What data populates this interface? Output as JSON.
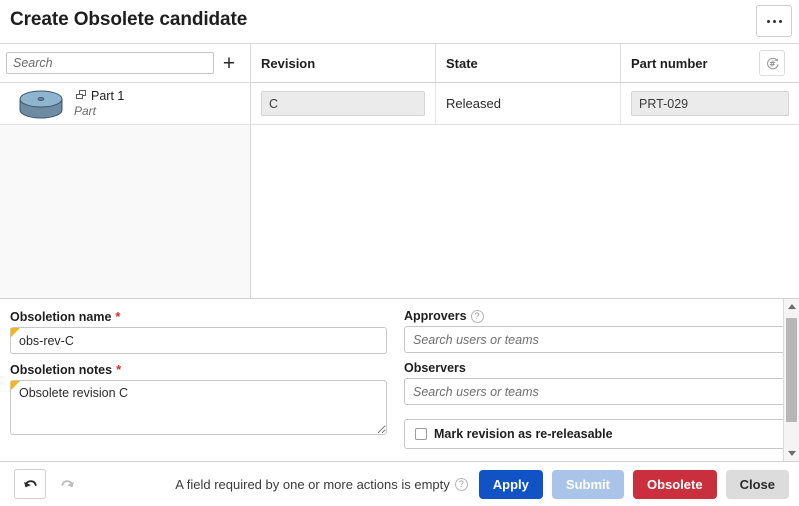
{
  "window": {
    "title": "Create Obsolete candidate",
    "more_menu_label": "•••"
  },
  "tree": {
    "search_placeholder": "Search",
    "search_value": "",
    "add_label": "+",
    "items": [
      {
        "name": "Part 1",
        "type": "Part",
        "thumbnail": "cylinder-part-thumbnail",
        "icon": "part-icon"
      }
    ]
  },
  "table": {
    "columns": [
      "Revision",
      "State",
      "Part number"
    ],
    "generate_number_icon": "hash-refresh-icon",
    "rows": [
      {
        "revision": "C",
        "state": "Released",
        "part_number": "PRT-029"
      }
    ]
  },
  "form": {
    "obsoletion_name": {
      "label": "Obsoletion name",
      "required_marker": "*",
      "value": "obs-rev-C",
      "placeholder": ""
    },
    "obsoletion_notes": {
      "label": "Obsoletion notes",
      "required_marker": "*",
      "value": "Obsolete revision C",
      "placeholder": ""
    },
    "approvers": {
      "label": "Approvers",
      "help_icon": "?",
      "value": "",
      "placeholder": "Search users or teams"
    },
    "observers": {
      "label": "Observers",
      "value": "",
      "placeholder": "Search users or teams"
    },
    "re_releasable": {
      "label": "Mark revision as re-releasable",
      "checked": false
    }
  },
  "footer": {
    "undo_icon": "undo-arrow-icon",
    "redo_icon": "redo-arrow-icon",
    "status_message": "A field required by one or more actions is empty",
    "status_help_icon": "?",
    "buttons": {
      "apply": "Apply",
      "submit": "Submit",
      "obsolete": "Obsolete",
      "close": "Close"
    }
  },
  "colors": {
    "apply": "#1153c4",
    "submit": "#a9c4e8",
    "obsolete": "#c92f3c",
    "close": "#dcdcdc",
    "required": "#cf2f33",
    "field_flag": "#f4b41a"
  }
}
